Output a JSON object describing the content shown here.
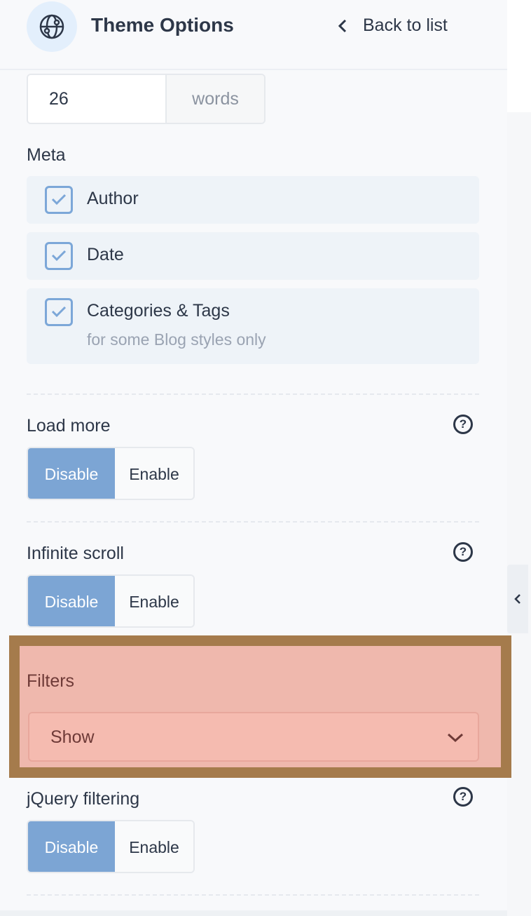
{
  "header": {
    "title": "Theme Options",
    "back_label": "Back to list",
    "icon": "globe-icon"
  },
  "excerpt": {
    "value": "26",
    "unit": "words"
  },
  "meta": {
    "label": "Meta",
    "items": [
      {
        "label": "Author",
        "checked": true
      },
      {
        "label": "Date",
        "checked": true
      },
      {
        "label": "Categories & Tags",
        "sublabel": "for some Blog styles only",
        "checked": true
      }
    ]
  },
  "load_more": {
    "label": "Load more",
    "options": [
      "Disable",
      "Enable"
    ],
    "selected": "Disable"
  },
  "infinite_scroll": {
    "label": "Infinite scroll",
    "options": [
      "Disable",
      "Enable"
    ],
    "selected": "Disable"
  },
  "filters": {
    "label": "Filters",
    "value": "Show"
  },
  "jquery_filtering": {
    "label": "jQuery filtering",
    "options": [
      "Disable",
      "Enable"
    ],
    "selected": "Disable"
  },
  "help_glyph": "?",
  "colors": {
    "accent": "#7ca5d4",
    "highlight_border": "#a57b4c",
    "highlight_fill": "#efb8ad"
  }
}
